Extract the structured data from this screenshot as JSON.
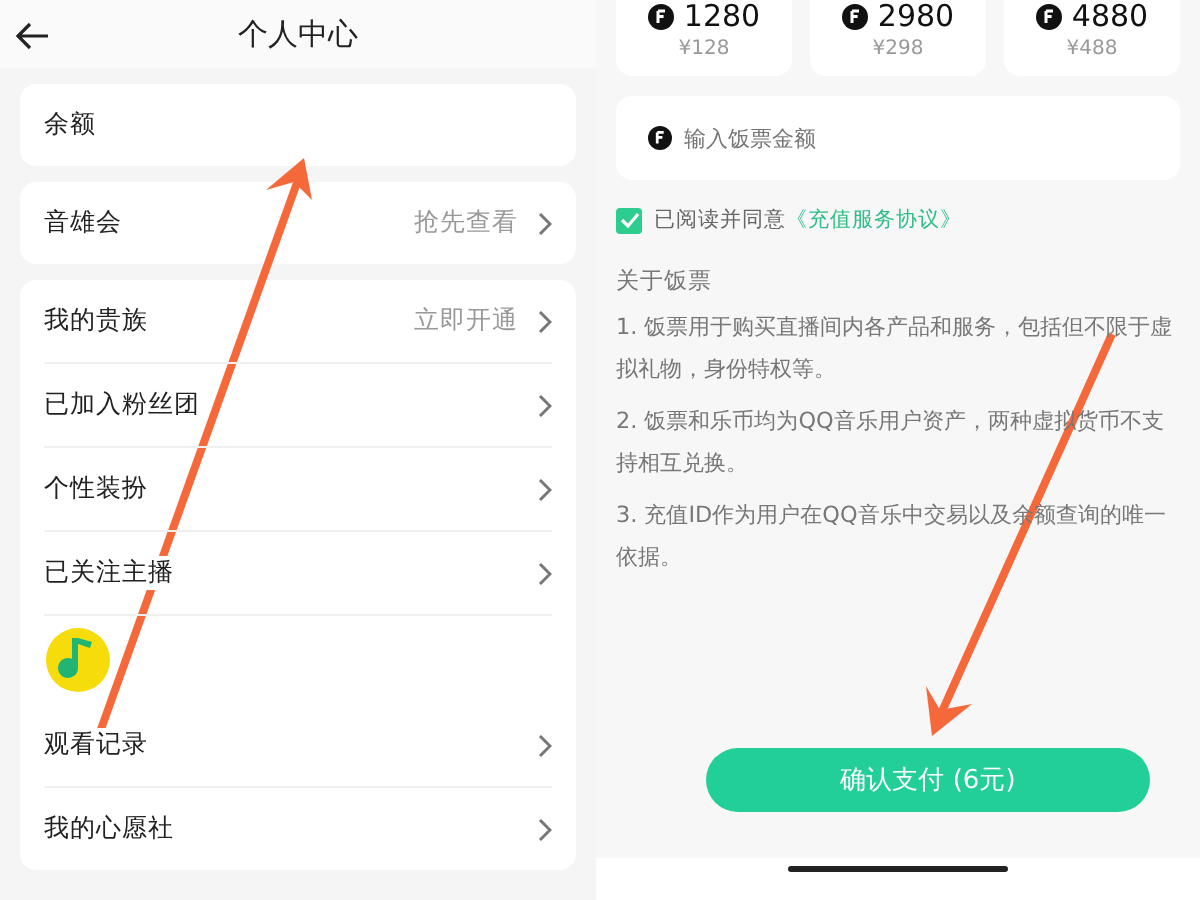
{
  "left": {
    "header": {
      "title": "个人中心"
    },
    "cards": [
      {
        "rows": [
          {
            "kind": "row",
            "label": "余额",
            "chevron": false
          }
        ]
      },
      {
        "rows": [
          {
            "kind": "row",
            "label": "音雄会",
            "value": "抢先查看",
            "chevron": true
          }
        ]
      },
      {
        "rows": [
          {
            "kind": "row",
            "label": "我的贵族",
            "value": "立即开通",
            "chevron": true
          },
          {
            "kind": "row",
            "label": "已加入粉丝团",
            "chevron": true
          },
          {
            "kind": "row",
            "label": "个性装扮",
            "chevron": true
          },
          {
            "kind": "row",
            "label": "已关注主播",
            "chevron": true
          },
          {
            "kind": "logo"
          },
          {
            "kind": "row",
            "label": "观看记录",
            "chevron": true
          },
          {
            "kind": "row",
            "label": "我的心愿社",
            "chevron": true
          }
        ]
      }
    ]
  },
  "right": {
    "packages": [
      {
        "amount": "1280",
        "price": "¥128"
      },
      {
        "amount": "2980",
        "price": "¥298"
      },
      {
        "amount": "4880",
        "price": "¥488"
      }
    ],
    "amount_input": {
      "placeholder": "输入饭票金额"
    },
    "agreement": {
      "checked": true,
      "text": "已阅读并同意",
      "link": "《充值服务协议》"
    },
    "about": {
      "title": "关于饭票",
      "items": [
        "1. 饭票用于购买直播间内各产品和服务，包括但不限于虚拟礼物，身份特权等。",
        "2. 饭票和乐币均为QQ音乐用户资产，两种虚拟货币不支持相互兑换。",
        "3. 充值ID作为用户在QQ音乐中交易以及余额查询的唯一依据。"
      ]
    },
    "confirm_button": "确认支付 (6元)"
  }
}
